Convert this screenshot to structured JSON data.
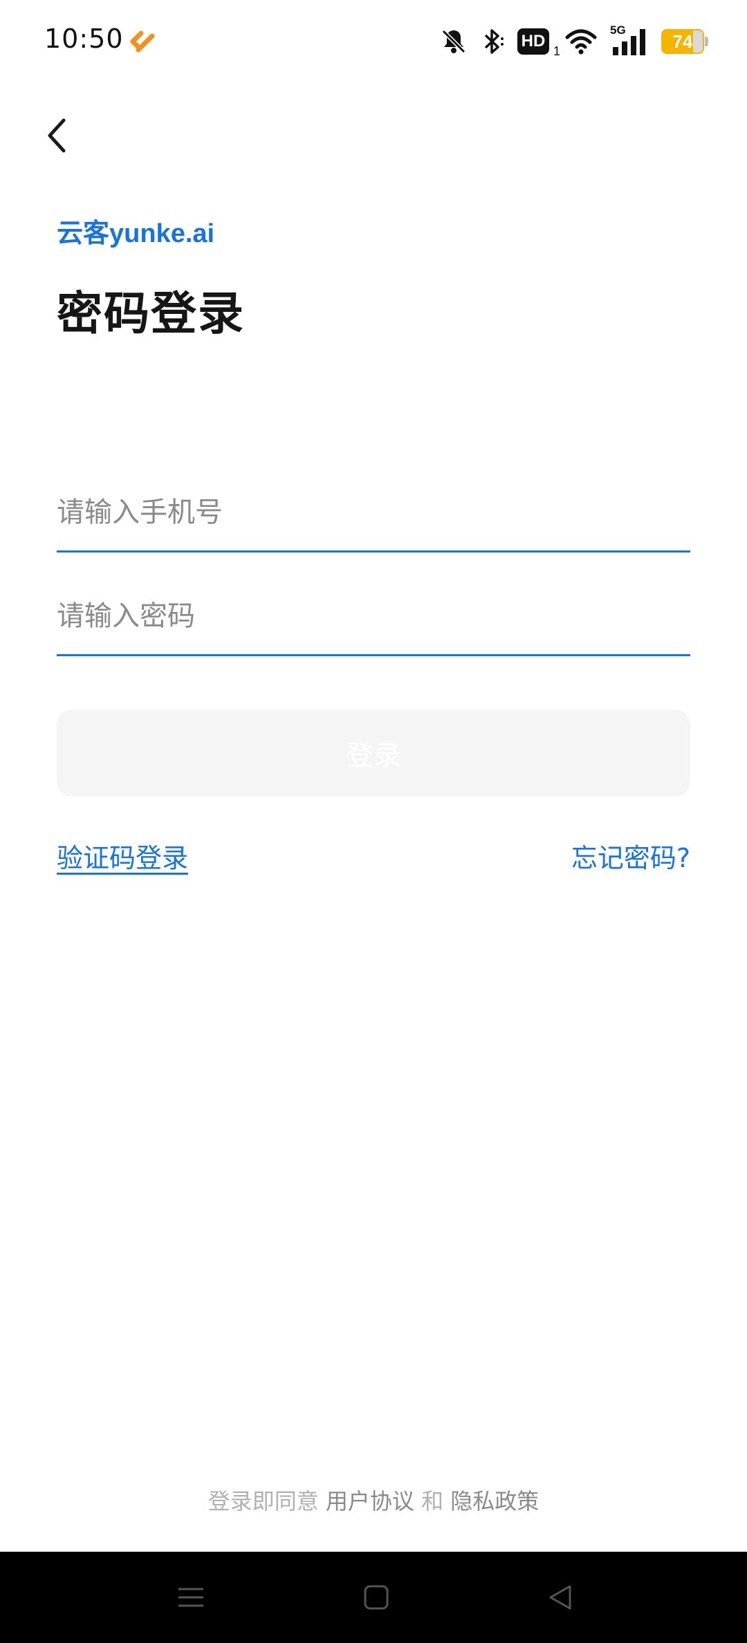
{
  "status_bar": {
    "time": "10:50",
    "hd_label": "HD",
    "hd_sub": "1",
    "network_label": "5G",
    "battery_percent": "74"
  },
  "header": {
    "brand": "云客yunke.ai",
    "title": "密码登录"
  },
  "form": {
    "phone_placeholder": "请输入手机号",
    "password_placeholder": "请输入密码",
    "login_label": "登录"
  },
  "links": {
    "sms_login": "验证码登录",
    "forgot_password": "忘记密码?"
  },
  "agreement": {
    "prefix": "登录即同意",
    "user_agreement": "用户协议",
    "conjunction": "和",
    "privacy_policy": "隐私政策"
  },
  "colors": {
    "accent": "#1872e0",
    "battery": "#f5b400",
    "app_badge": "#f0921e"
  }
}
